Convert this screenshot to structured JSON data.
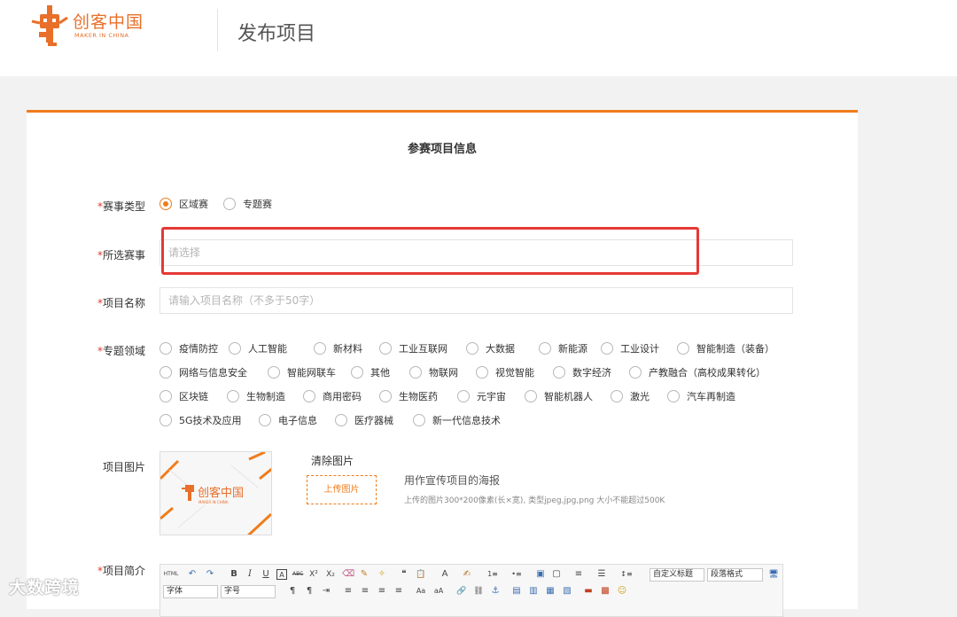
{
  "header": {
    "logo_text": "创客中国",
    "logo_sub": "MAKER IN CHINA",
    "page_title": "发布项目"
  },
  "form": {
    "section_title": "参赛项目信息",
    "required_mark": "*",
    "event_type": {
      "label": "赛事类型",
      "options": [
        "区域赛",
        "专题赛"
      ],
      "selected": "区域赛"
    },
    "selected_event": {
      "label": "所选赛事",
      "placeholder": "请选择"
    },
    "project_name": {
      "label": "项目名称",
      "placeholder": "请输入项目名称（不多于50字）"
    },
    "topic_field": {
      "label": "专题领域",
      "options": [
        "疫情防控",
        "人工智能",
        "新材料",
        "工业互联网",
        "大数据",
        "新能源",
        "工业设计",
        "智能制造（装备）",
        "网络与信息安全",
        "智能网联车",
        "其他",
        "物联网",
        "视觉智能",
        "数字经济",
        "产教融合（高校成果转化）",
        "区块链",
        "生物制造",
        "商用密码",
        "生物医药",
        "元宇宙",
        "智能机器人",
        "激光",
        "汽车再制造",
        "5G技术及应用",
        "电子信息",
        "医疗器械",
        "新一代信息技术"
      ]
    },
    "project_image": {
      "label": "项目图片",
      "clear_label": "清除图片",
      "upload_label": "上传图片",
      "hint_title": "用作宣传项目的海报",
      "hint_detail": "上传的图片300*200像素(长×宽), 类型jpeg,jpg,png 大小不能超过500K"
    },
    "project_intro": {
      "label": "项目简介",
      "toolbar": {
        "heading_select": "自定义标题",
        "paragraph_select": "段落格式",
        "font_select": "字体",
        "size_select": "字号",
        "row1_icons": [
          "html-icon",
          "undo-icon",
          "redo-icon",
          "bold-icon",
          "italic-icon",
          "underline-icon",
          "border-icon",
          "strikethrough-icon",
          "superscript-icon",
          "subscript-icon",
          "eraser-icon",
          "format-brush-icon",
          "auto-format-icon",
          "quote-icon",
          "paste-text-icon",
          "font-color-icon",
          "highlight-icon",
          "ordered-list-icon",
          "unordered-list-icon",
          "select-all-icon",
          "clear-doc-icon",
          "line-height-icon",
          "paragraph-spacing-icon",
          "row-spacing-icon",
          "preview-icon"
        ],
        "glyphs": {
          "html": "HTML",
          "undo": "↶",
          "redo": "↷",
          "bold": "B",
          "italic": "I",
          "underline": "U",
          "border": "A",
          "strike": "ABC",
          "sup": "X²",
          "sub": "X₂",
          "eraser": "⌫",
          "brush": "✎",
          "magic": "✧",
          "quote": "❝",
          "paste": "📋",
          "fontcolor": "A",
          "highlight": "✍",
          "ol": "1≡",
          "ul": "•≡",
          "selectall": "▣",
          "doc": "▢",
          "lh": "≡",
          "ps": "☰",
          "rs": "↕≡",
          "monitor": "🖥",
          "ltr": "¶",
          "rtl": "¶",
          "indent": "⇥",
          "al": "≡",
          "ac": "≡",
          "ar": "≡",
          "aj": "≡",
          "upper": "Aa",
          "lower": "aA",
          "link": "🔗",
          "unlink": "⛓",
          "anchor": "⚓",
          "img1": "▤",
          "img2": "▥",
          "img3": "▦",
          "img4": "▧",
          "media": "▬",
          "gallery": "▩",
          "emoji": "☺"
        }
      }
    }
  },
  "watermark": "大数跨境",
  "colors": {
    "accent": "#f07c1b",
    "required": "#e03a2d",
    "highlight_box": "#e53935"
  }
}
